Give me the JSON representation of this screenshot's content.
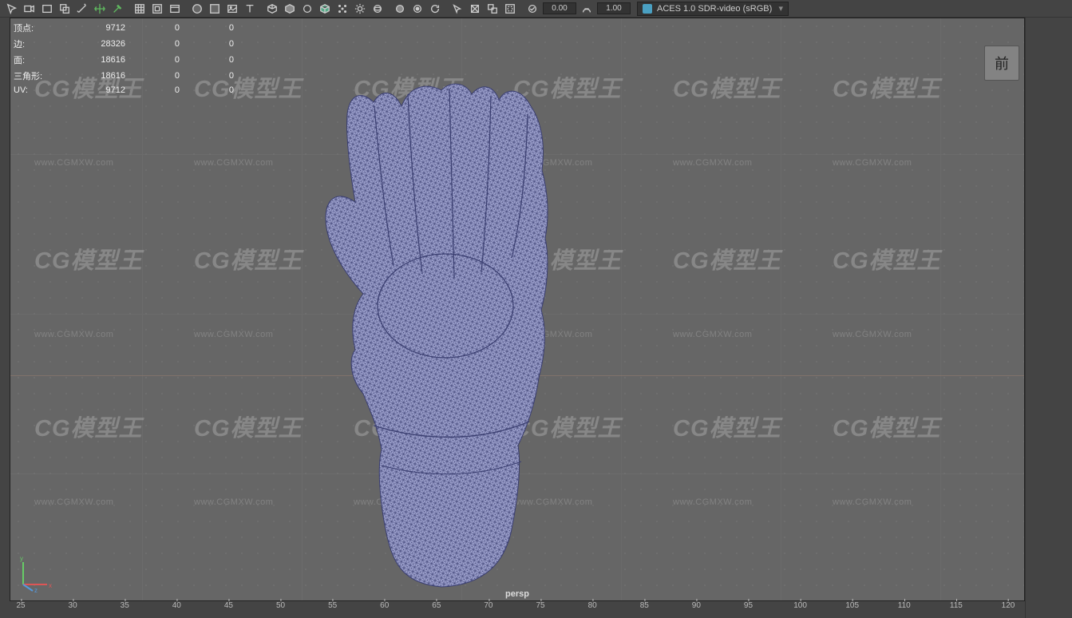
{
  "toolbar": {
    "num_a": "0.00",
    "num_b": "1.00",
    "color_space": "ACES 1.0 SDR-video (sRGB)"
  },
  "stats": {
    "rows": [
      {
        "label": "顶点:",
        "v1": "9712",
        "v2": "0",
        "v3": "0"
      },
      {
        "label": "边:",
        "v1": "28326",
        "v2": "0",
        "v3": "0"
      },
      {
        "label": "面:",
        "v1": "18616",
        "v2": "0",
        "v3": "0"
      },
      {
        "label": "三角形:",
        "v1": "18616",
        "v2": "0",
        "v3": "0"
      },
      {
        "label": "UV:",
        "v1": "9712",
        "v2": "0",
        "v3": "0"
      }
    ]
  },
  "watermark": {
    "big": "CG模型王",
    "small": "www.CGMXW.com"
  },
  "orient_label": "前",
  "camera": "persp",
  "ruler_marks": [
    "25",
    "30",
    "35",
    "40",
    "45",
    "50",
    "55",
    "60",
    "65",
    "70",
    "75",
    "80",
    "85",
    "90",
    "95",
    "100",
    "105",
    "110",
    "115",
    "120"
  ]
}
